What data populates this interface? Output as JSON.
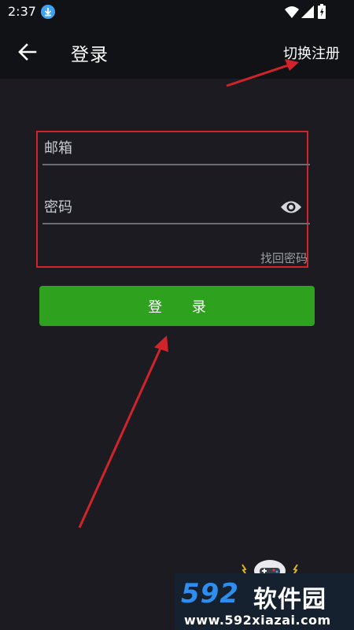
{
  "status_bar": {
    "time": "2:37",
    "icons": [
      "download-icon",
      "wifi-icon",
      "signal-icon",
      "battery-icon"
    ]
  },
  "app_bar": {
    "back_icon": "arrow-left-icon",
    "title": "登录",
    "switch_label": "切换注册"
  },
  "form": {
    "email": {
      "placeholder": "邮箱",
      "value": ""
    },
    "password": {
      "placeholder": "密码",
      "value": "",
      "toggle_icon": "eye-icon"
    },
    "forgot_label": "找回密码"
  },
  "login_button": {
    "label": "登 录"
  },
  "watermark": {
    "number": "592",
    "name": "软件园",
    "url": "www.592xiazai.com"
  },
  "colors": {
    "background": "#1b1b21",
    "bar": "#111216",
    "primary_button": "#2ea11f",
    "annotation_red": "#d0242a",
    "watermark_blue": "#2d8ef0"
  }
}
